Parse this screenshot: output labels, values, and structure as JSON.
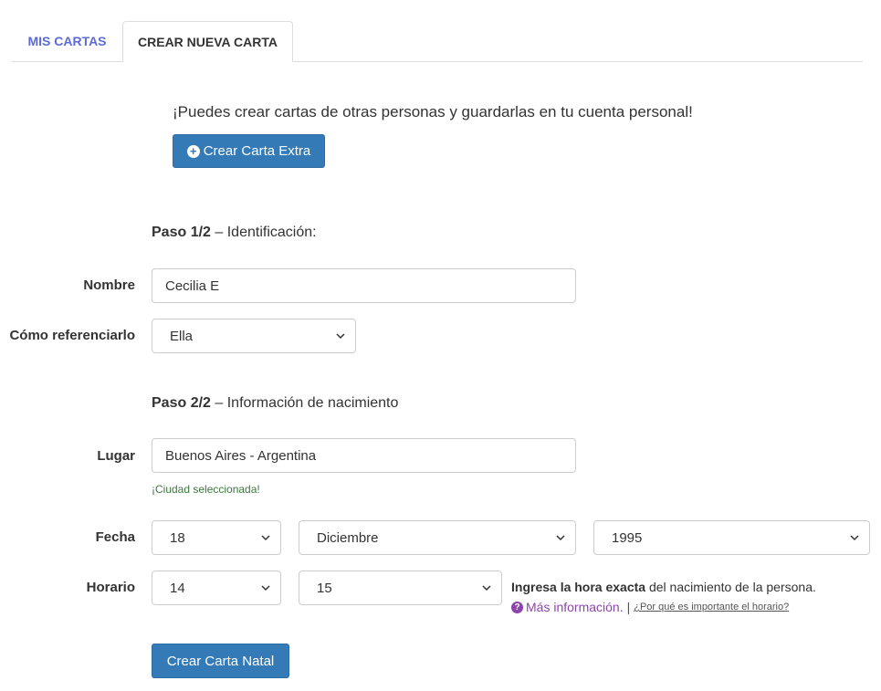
{
  "tabs": {
    "mis_cartas": "MIS CARTAS",
    "crear_nueva": "CREAR NUEVA CARTA"
  },
  "intro": {
    "text": "¡Puedes crear cartas de otras personas y guardarlas en tu cuenta personal!",
    "button_label": "Crear Carta Extra"
  },
  "step1": {
    "title": "Paso 1/2",
    "dash": " – ",
    "subtitle": "Identificación:"
  },
  "nombre": {
    "label": "Nombre",
    "value": "Cecilia E"
  },
  "referencia": {
    "label": "Cómo referenciarlo",
    "value": "Ella"
  },
  "step2": {
    "title": "Paso 2/2",
    "dash": " – ",
    "subtitle": "Información de nacimiento"
  },
  "lugar": {
    "label": "Lugar",
    "value": "Buenos Aires - Argentina",
    "status": "¡Ciudad seleccionada!"
  },
  "fecha": {
    "label": "Fecha",
    "day": "18",
    "month": "Diciembre",
    "year": "1995"
  },
  "horario": {
    "label": "Horario",
    "hour": "14",
    "minute": "15"
  },
  "hint": {
    "bold": "Ingresa la hora exacta",
    "rest": " del nacimiento de la persona.",
    "more_info": "Más información.",
    "separator": "|",
    "why_link": "¿Por qué es importante el horario?"
  },
  "submit_label": "Crear Carta Natal",
  "colors": {
    "primary": "#337ab7",
    "tab_active_link": "#5b6bd8",
    "success": "#3c763d",
    "info_link": "#8e44ad"
  }
}
